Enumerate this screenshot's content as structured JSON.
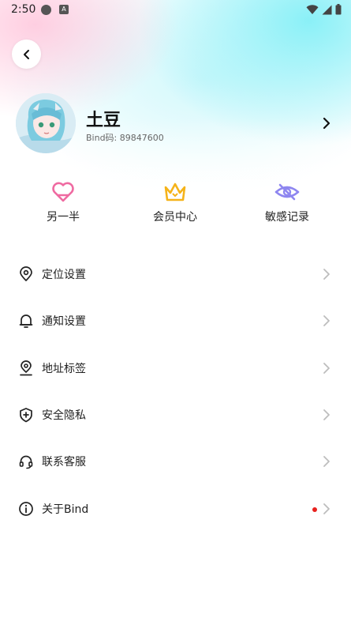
{
  "status_bar": {
    "time": "2:50",
    "a_badge": "A"
  },
  "profile": {
    "name": "土豆",
    "bind_label": "Bind码: ",
    "bind_code": "89847600"
  },
  "quick_actions": [
    {
      "label": "另一半",
      "icon": "heart-icon",
      "color": "#ef6aa1"
    },
    {
      "label": "会员中心",
      "icon": "crown-icon",
      "color": "#f5b319"
    },
    {
      "label": "敏感记录",
      "icon": "eye-slash-icon",
      "color": "#8e86f0"
    }
  ],
  "menu": [
    {
      "label": "定位设置",
      "icon": "location-pin-icon"
    },
    {
      "label": "通知设置",
      "icon": "bell-icon"
    },
    {
      "label": "地址标签",
      "icon": "map-pin-icon"
    },
    {
      "label": "安全隐私",
      "icon": "shield-icon"
    },
    {
      "label": "联系客服",
      "icon": "headset-icon"
    },
    {
      "label": "关于Bind",
      "icon": "info-icon",
      "has_dot": true
    }
  ],
  "colors": {
    "dot": "#e8211e",
    "chevron": "#bdbdbd"
  }
}
